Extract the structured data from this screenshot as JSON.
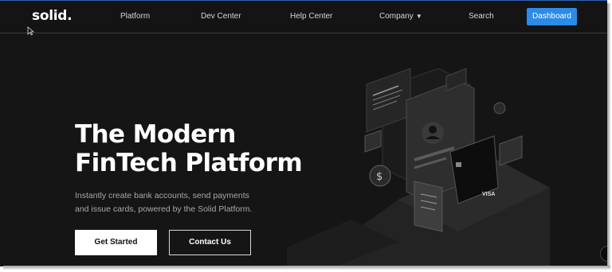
{
  "header": {
    "logo": "solid.",
    "nav": [
      {
        "label": "Platform"
      },
      {
        "label": "Dev Center"
      },
      {
        "label": "Help Center"
      },
      {
        "label": "Company"
      },
      {
        "label": "Search"
      }
    ],
    "dashboard_label": "Dashboard"
  },
  "hero": {
    "title_line1": "The Modern",
    "title_line2": "FinTech Platform",
    "subtitle_line1": "Instantly create bank accounts, send payments",
    "subtitle_line2": "and issue cards, powered by the Solid Platform.",
    "primary_cta": "Get Started",
    "secondary_cta": "Contact Us",
    "card_brand": "VISA"
  },
  "colors": {
    "background": "#151515",
    "accent": "#2b8be6",
    "text": "#ffffff"
  }
}
